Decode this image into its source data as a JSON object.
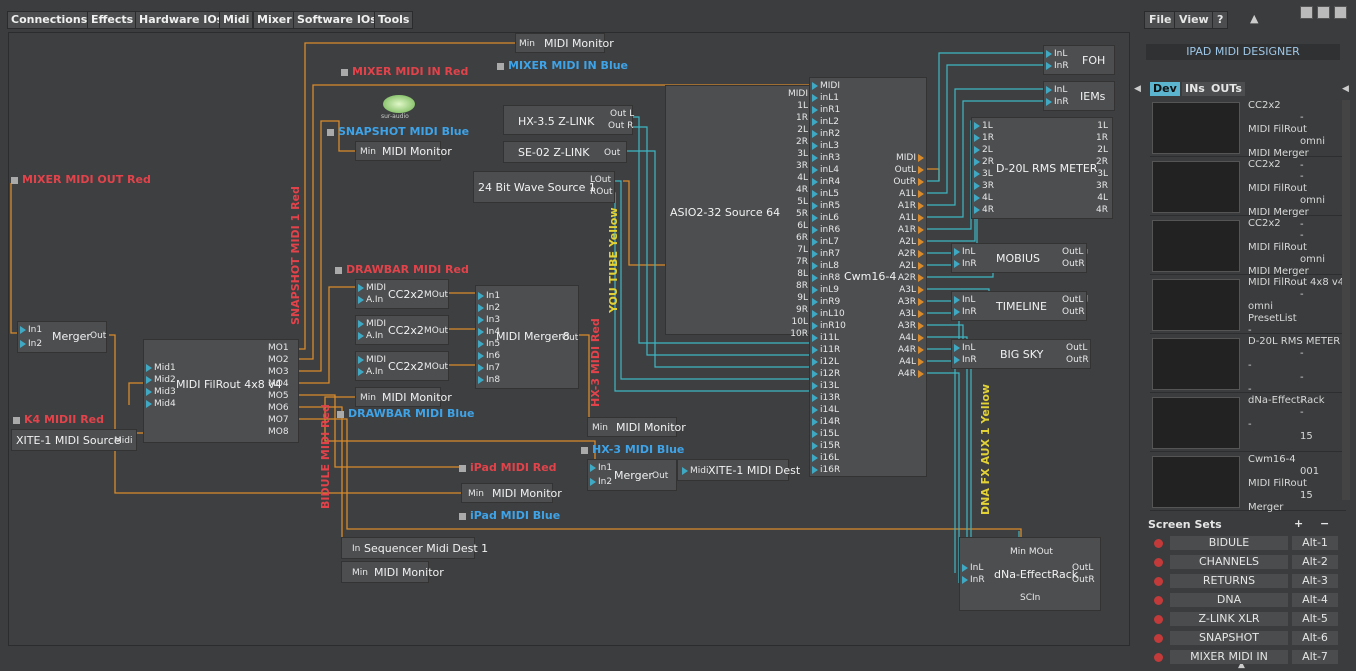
{
  "menu": [
    "Connections",
    "Effects",
    "Hardware IOs",
    "Midi",
    "Mixer",
    "Software IOs",
    "Tools"
  ],
  "colors": {
    "wire_orange": "#d98a2b",
    "wire_cyan": "#3fb7c4",
    "label_red": "#e2434b",
    "label_blue": "#3fa3e8",
    "label_yellow": "#e3d235",
    "bg": "#3d3f40"
  },
  "labels": {
    "mixer_midi_in_red": "MIXER MIDI IN Red",
    "mixer_midi_in_blue": "MIXER MIDI IN Blue",
    "snapshot_midi_blue": "SNAPSHOT MIDI Blue",
    "mixer_midi_out_red": "MIXER MIDI OUT Red",
    "snapshot_midi1_red": "SNAPSHOT MIDI 1 Red",
    "drawbar_midi_red": "DRAWBAR MIDI Red",
    "drawbar_midi_blue": "DRAWBAR MIDI Blue",
    "k4_midi_red": "K4 MIDII Red",
    "bidule_midi_red": "BIDULE MIDI Red",
    "ipad_midi_red": "iPad MIDI Red",
    "ipad_midi_blue": "iPad MIDI Blue",
    "youtube_yellow": "YOU TUBE Yellow",
    "hx3_midi_red_v": "HX-3 MIDI Red",
    "hx3_midi_blue": "HX-3 MIDI Blue",
    "dna_fx_aux": "DNA FX AUX 1 Yellow",
    "logo_text": "sur-audio"
  },
  "nodes": {
    "midi_monitor": "MIDI Monitor",
    "min": "Min",
    "merger": "Merger",
    "in1": "In1",
    "in2": "In2",
    "out": "Out",
    "filrout": "MIDI FilRout 4x8 v4",
    "mid": [
      "Mid1",
      "Mid2",
      "Mid3",
      "Mid4"
    ],
    "mo": [
      "MO1",
      "MO2",
      "MO3",
      "MO4",
      "MO5",
      "MO6",
      "MO7",
      "MO8"
    ],
    "xite_source": "XITE-1 MIDI Source",
    "midi_port": "Midi",
    "cc2x2": "CC2x2",
    "midi": "MIDI",
    "ain": "A.In",
    "mout": "MOut",
    "merger8": "MIDI Merger8",
    "merger8_ins": [
      "In1",
      "In2",
      "In3",
      "In4",
      "In5",
      "In6",
      "In7",
      "In8"
    ],
    "seq_dest": "Sequencer Midi Dest 1",
    "in": "In",
    "xite_dest": "XITE-1 MIDI Dest",
    "hx35": "HX-3.5  Z-LINK",
    "outl": "Out L",
    "outr": "Out R",
    "se02": "SE-02  Z-LINK",
    "wave": "24 Bit Wave Source 1",
    "lout": "LOut",
    "rout": "ROut",
    "asio": "ASIO2-32 Source 64",
    "cwm": "Cwm16-4",
    "cwm_ins": [
      "MIDI",
      "1L",
      "1R",
      "2L",
      "2R",
      "3L",
      "3R",
      "4L",
      "4R",
      "5L",
      "5R",
      "6L",
      "6R",
      "7L",
      "7R",
      "8L",
      "8R",
      "9L",
      "9R",
      "10L",
      "10R"
    ],
    "cwm_in_ports": [
      "MIDI",
      "inL1",
      "inR1",
      "inL2",
      "inR2",
      "inL3",
      "inR3",
      "inL4",
      "inR4",
      "inL5",
      "inR5",
      "inL6",
      "inR6",
      "inL7",
      "inR7",
      "inL8",
      "inR8",
      "inL9",
      "inR9",
      "inL10",
      "inR10",
      "i11L",
      "i11R",
      "i12L",
      "i12R",
      "i13L",
      "i13R",
      "i14L",
      "i14R",
      "i15L",
      "i15R",
      "i16L",
      "i16R"
    ],
    "cwm_outs": [
      "MIDI",
      "OutL",
      "OutR",
      "A1L",
      "A1R",
      "A1L",
      "A1R",
      "A2L",
      "A2R",
      "A2L",
      "A2R",
      "A3L",
      "A3R",
      "A3L",
      "A3R",
      "A4L",
      "A4R",
      "A4L",
      "A4R"
    ],
    "foh": "FOH",
    "iems": "IEMs",
    "inl": "InL",
    "inr": "InR",
    "meter": "D-20L RMS METER",
    "meter_ports": [
      "1L",
      "1R",
      "2L",
      "2R",
      "3L",
      "3R",
      "4L",
      "4R"
    ],
    "mobius": "MOBIUS",
    "timeline": "TIMELINE",
    "bigsky": "BIG SKY",
    "effectrack": "dNa-EffectRack",
    "scin": "SCIn",
    "minmout": "Min MOut",
    "outl2": "OutL",
    "outr2": "OutR"
  },
  "right_panel": {
    "buttons": [
      "File",
      "View",
      "?"
    ],
    "designer": "IPAD MIDI DESIGNER",
    "tabs": [
      "Dev",
      "INs",
      "OUTs"
    ],
    "devices": [
      {
        "lines": [
          "CC2x2",
          "-",
          "MIDI FilRout",
          "omni",
          "MIDI Merger",
          "-"
        ]
      },
      {
        "lines": [
          "CC2x2",
          "-",
          "MIDI FilRout",
          "omni",
          "MIDI Merger",
          "-"
        ]
      },
      {
        "lines": [
          "CC2x2",
          "-",
          "MIDI FilRout",
          "omni",
          "MIDI Merger",
          "-"
        ]
      },
      {
        "lines": [
          "MIDI FilRout 4x8 v4",
          "-",
          "omni",
          "PresetList",
          "-"
        ]
      },
      {
        "lines": [
          "D-20L RMS METER",
          "-",
          "-",
          "-",
          "-",
          "-"
        ]
      },
      {
        "lines": [
          "dNa-EffectRack",
          "-",
          "-",
          "15"
        ]
      },
      {
        "lines": [
          "Cwm16-4",
          "001",
          "MIDI FilRout",
          "15",
          "Merger"
        ]
      }
    ],
    "screen_sets_title": "Screen Sets",
    "screen_sets": [
      {
        "name": "BIDULE",
        "key": "Alt-1"
      },
      {
        "name": "CHANNELS",
        "key": "Alt-2"
      },
      {
        "name": "RETURNS",
        "key": "Alt-3"
      },
      {
        "name": "DNA",
        "key": "Alt-4"
      },
      {
        "name": "Z-LINK  XLR",
        "key": "Alt-5"
      },
      {
        "name": "SNAPSHOT",
        "key": "Alt-6"
      },
      {
        "name": "MIXER MIDI IN",
        "key": "Alt-7"
      }
    ],
    "plus": "+",
    "minus": "−"
  }
}
